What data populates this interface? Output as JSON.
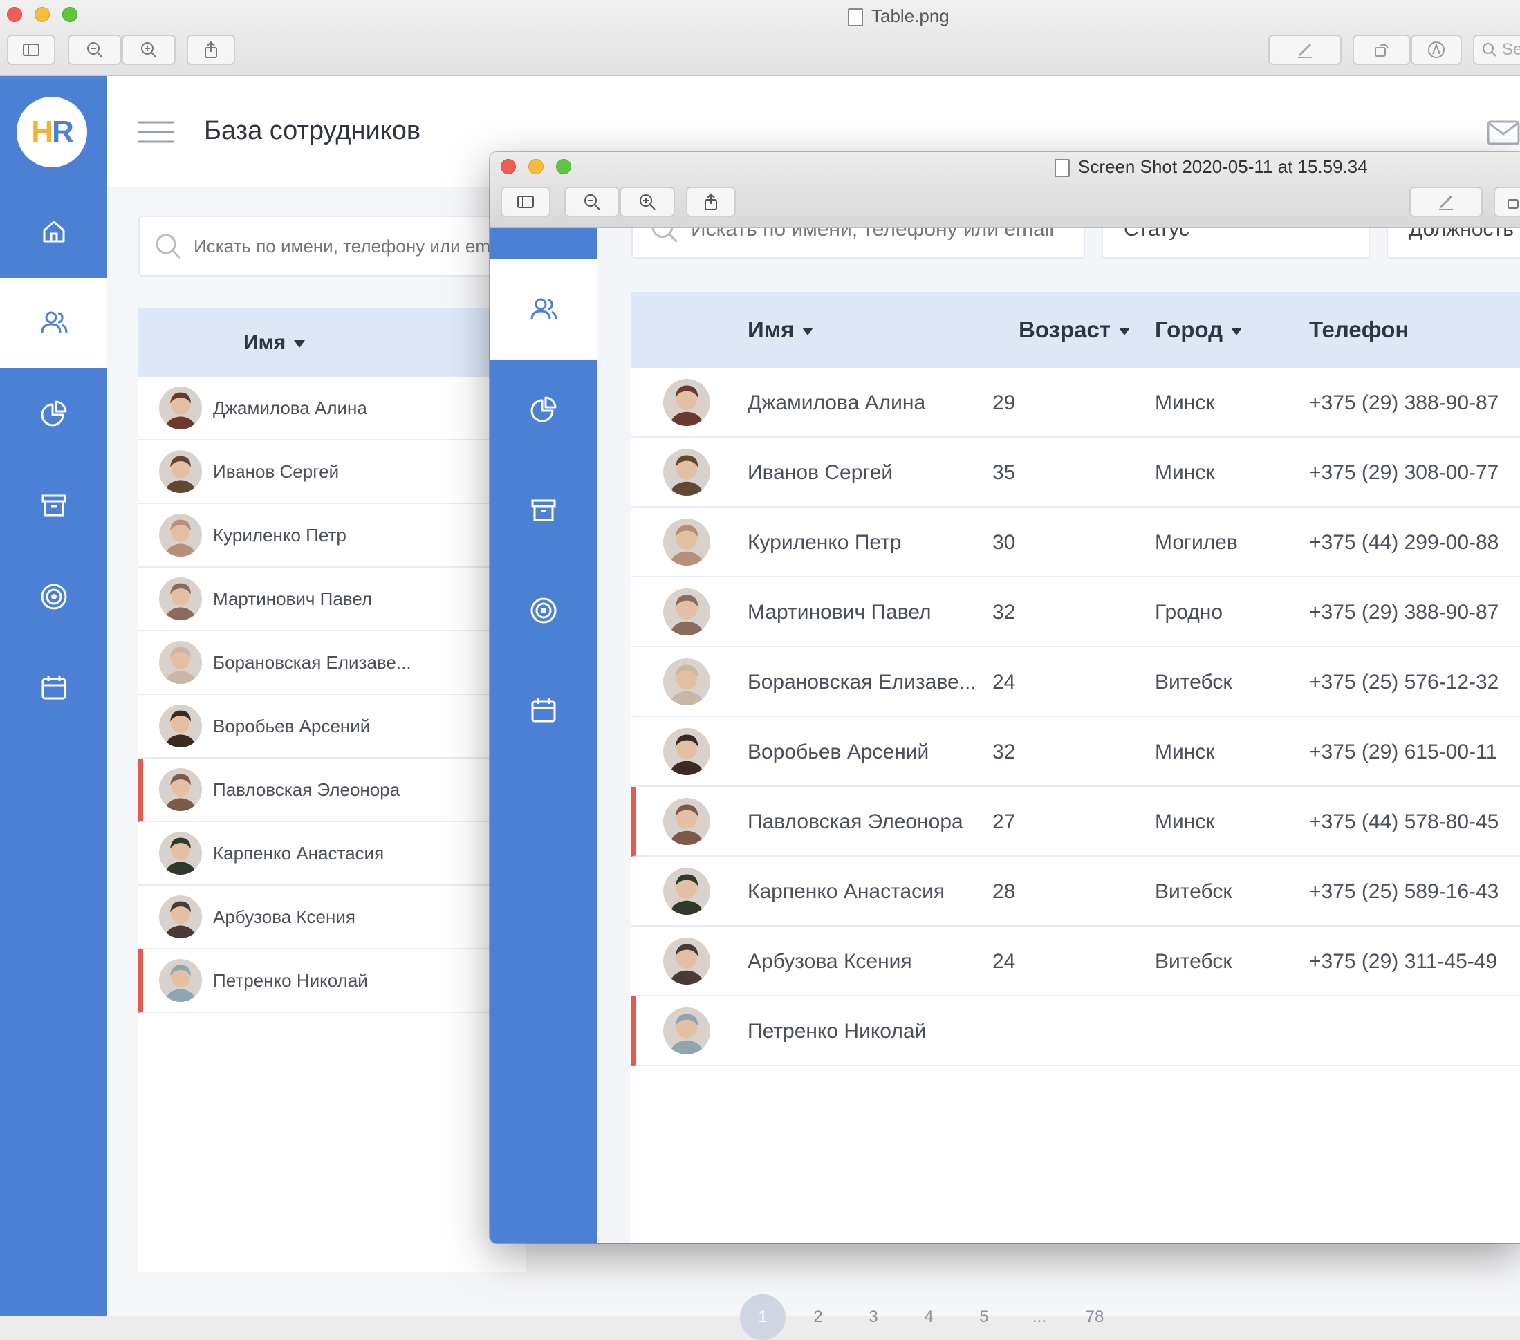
{
  "viewer_back": {
    "title": "Table.png",
    "search_placeholder": "Se"
  },
  "viewer_front": {
    "title": "Screen Shot 2020-05-11 at 15.59.34"
  },
  "app": {
    "logo": "HR",
    "page_title": "База сотрудников",
    "search_placeholder": "Искать по имени, телефону или email",
    "filters": {
      "status": "Статус",
      "position": "Должность"
    },
    "nav": [
      {
        "icon": "home-icon"
      },
      {
        "icon": "users-icon"
      },
      {
        "icon": "pie-chart-icon"
      },
      {
        "icon": "archive-icon"
      },
      {
        "icon": "target-icon"
      },
      {
        "icon": "calendar-icon"
      }
    ],
    "columns": {
      "name": "Имя",
      "age": "Возраст",
      "city": "Город",
      "phone": "Телефон"
    },
    "employees": [
      {
        "name": "Джамилова Алина",
        "age": "29",
        "city": "Минск",
        "phone": "+375 (29) 388-90-87",
        "flag": false,
        "avatar": "#6a3a2c"
      },
      {
        "name": "Иванов Сергей",
        "age": "35",
        "city": "Минск",
        "phone": "+375 (29) 308-00-77",
        "flag": false,
        "avatar": "#5e4a33"
      },
      {
        "name": "Куриленко Петр",
        "age": "30",
        "city": "Могилев",
        "phone": "+375 (44) 299-00-88",
        "flag": false,
        "avatar": "#b8907a"
      },
      {
        "name": "Мартинович Павел",
        "age": "32",
        "city": "Гродно",
        "phone": "+375 (29) 388-90-87",
        "flag": false,
        "avatar": "#8a6a58"
      },
      {
        "name": "Борановская Елизаве...",
        "age": "24",
        "city": "Витебск",
        "phone": "+375 (25) 576-12-32",
        "flag": false,
        "avatar": "#c9b7a6"
      },
      {
        "name": "Воробьев Арсений",
        "age": "32",
        "city": "Минск",
        "phone": "+375 (29) 615-00-11",
        "flag": false,
        "avatar": "#3a2a22"
      },
      {
        "name": "Павловская Элеонора",
        "age": "27",
        "city": "Минск",
        "phone": "+375 (44) 578-80-45",
        "flag": true,
        "avatar": "#7d5a48"
      },
      {
        "name": "Карпенко Анастасия",
        "age": "28",
        "city": "Витебск",
        "phone": "+375 (25) 589-16-43",
        "flag": false,
        "avatar": "#2f3a2a"
      },
      {
        "name": "Арбузова Ксения",
        "age": "24",
        "city": "Витебск",
        "phone": "+375 (29) 311-45-49",
        "flag": false,
        "avatar": "#4a3a36"
      },
      {
        "name": "Петренко Николай",
        "age": "",
        "city": "",
        "phone": "",
        "flag": true,
        "avatar": "#8fa6b0"
      }
    ],
    "pagination": [
      "1",
      "2",
      "3",
      "4",
      "5",
      "...",
      "78"
    ]
  }
}
